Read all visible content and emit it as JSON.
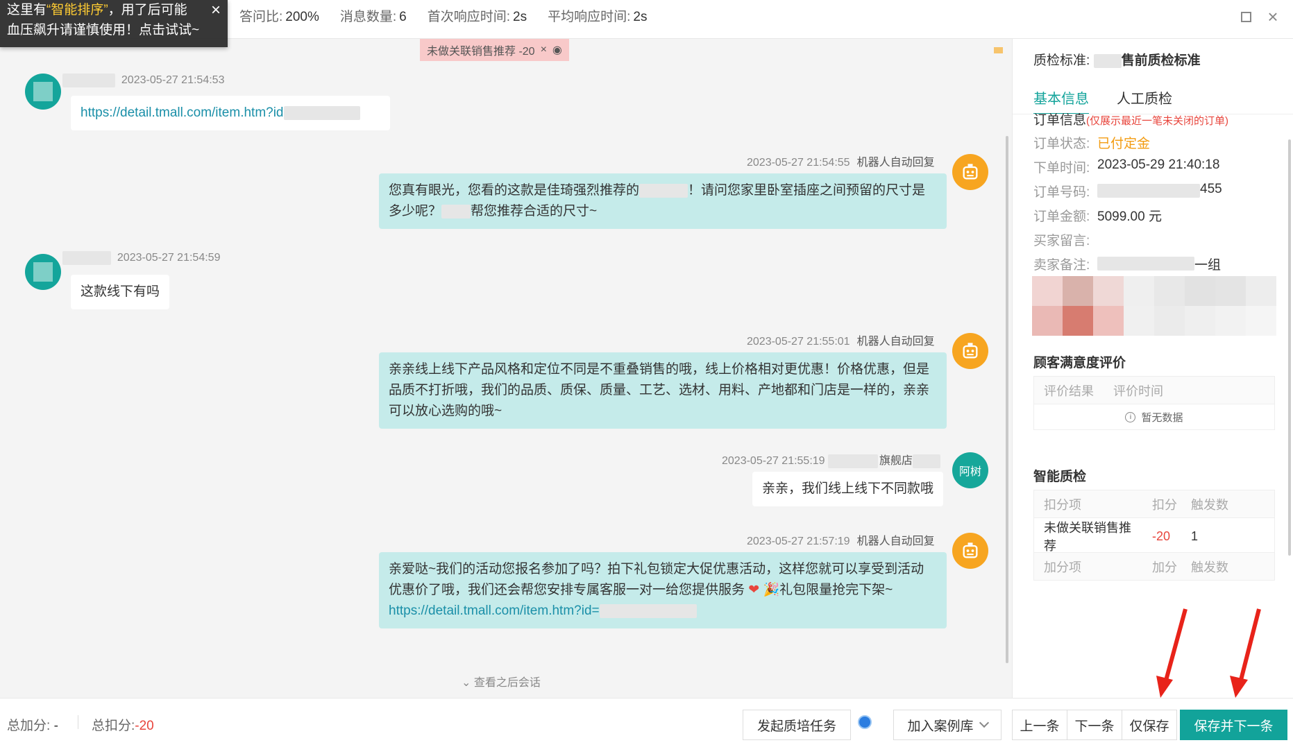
{
  "toast": {
    "text_prefix": "这里有",
    "highlight": "“智能排序”",
    "text_suffix": "，用了后可能",
    "line2": "血压飙升请谨慎使用！点击试试~",
    "close_icon": "×"
  },
  "header": {
    "stats": [
      {
        "label": "答问比:",
        "value": "200%"
      },
      {
        "label": "消息数量:",
        "value": "6"
      },
      {
        "label": "首次响应时间:",
        "value": "2s"
      },
      {
        "label": "平均响应时间:",
        "value": "2s"
      }
    ]
  },
  "chat": {
    "deduct_tag": {
      "label": "未做关联销售推荐 -20",
      "close": "×",
      "eye": "◉"
    },
    "messages": [
      {
        "side": "left",
        "time": "2023-05-27 21:54:53",
        "text": "https://detail.tmall.com/item.htm?id"
      },
      {
        "side": "right",
        "time": "2023-05-27 21:54:55",
        "source": "机器人自动回复",
        "text_a": "您真有眼光，您看的这款是佳琦强烈推荐的",
        "text_b": "！请问您家里卧室插座之间预留的尺寸是多少呢？",
        "text_c": "帮您推荐合适的尺寸~"
      },
      {
        "side": "left",
        "time": "2023-05-27 21:54:59",
        "text": "这款线下有吗"
      },
      {
        "side": "right",
        "time": "2023-05-27 21:55:01",
        "source": "机器人自动回复",
        "text": "亲亲线上线下产品风格和定位不同是不重叠销售的哦，线上价格相对更优惠！价格优惠，但是品质不打折哦，我们的品质、质保、质量、工艺、选材、用料、产地都和门店是一样的，亲亲可以放心选购的哦~"
      },
      {
        "side": "right",
        "time": "2023-05-27 21:55:19",
        "source": "旗舰店",
        "avatar_text": "阿树",
        "text": "亲亲，我们线上线下不同款哦"
      },
      {
        "side": "right",
        "time": "2023-05-27 21:57:19",
        "source": "机器人自动回复",
        "text_a": "亲爱哒~我们的活动您报名参加了吗？拍下礼包锁定大促优惠活动，这样您就可以享受到活动优惠价了哦，我们还会帮您安排专属客服一对一给您提供服务",
        "text_b": "礼包限量抢完下架~",
        "link": "http",
        "link2": "s://detail.tmall.com/item.htm?id="
      }
    ],
    "more_label": "⌄ 查看之后会话"
  },
  "panel": {
    "qc_label": "质检标准:",
    "qc_value": "售前质检标准",
    "tabs": [
      "基本信息",
      "人工质检"
    ],
    "order_title": "订单信息",
    "order_note": "(仅展示最近一笔未关闭的订单)",
    "order": [
      {
        "k": "订单状态:",
        "v": "已付定金"
      },
      {
        "k": "下单时间:",
        "v": "2023-05-29 21:40:18"
      },
      {
        "k": "订单号码:",
        "v": "455"
      },
      {
        "k": "订单金额:",
        "v": "5099.00 元"
      },
      {
        "k": "买家留言:",
        "v": ""
      },
      {
        "k": "卖家备注:",
        "v": "一组"
      }
    ],
    "satisfaction_title": "顾客满意度评价",
    "satisfaction_headers": [
      "评价结果",
      "评价时间"
    ],
    "empty_text": "暂无数据",
    "smart_title": "智能质检",
    "smart_headers": [
      "扣分项",
      "扣分",
      "触发数"
    ],
    "smart_rows": [
      {
        "item": "未做关联销售推荐",
        "score": "-20",
        "count": "1"
      }
    ],
    "add_headers": [
      "加分项",
      "加分",
      "触发数"
    ]
  },
  "footer": {
    "total_add_label": "总加分:",
    "total_add_value": "-",
    "total_deduct_label": "总扣分:",
    "total_deduct_value": "-20",
    "btn_train": "发起质培任务",
    "btn_case": "加入案例库",
    "btn_prev": "上一条",
    "btn_next": "下一条",
    "btn_save": "仅保存",
    "btn_save_next": "保存并下一条"
  },
  "colors": {
    "accent": "#12a39a",
    "bot": "#f7a520",
    "deduct": "#e8453c"
  }
}
